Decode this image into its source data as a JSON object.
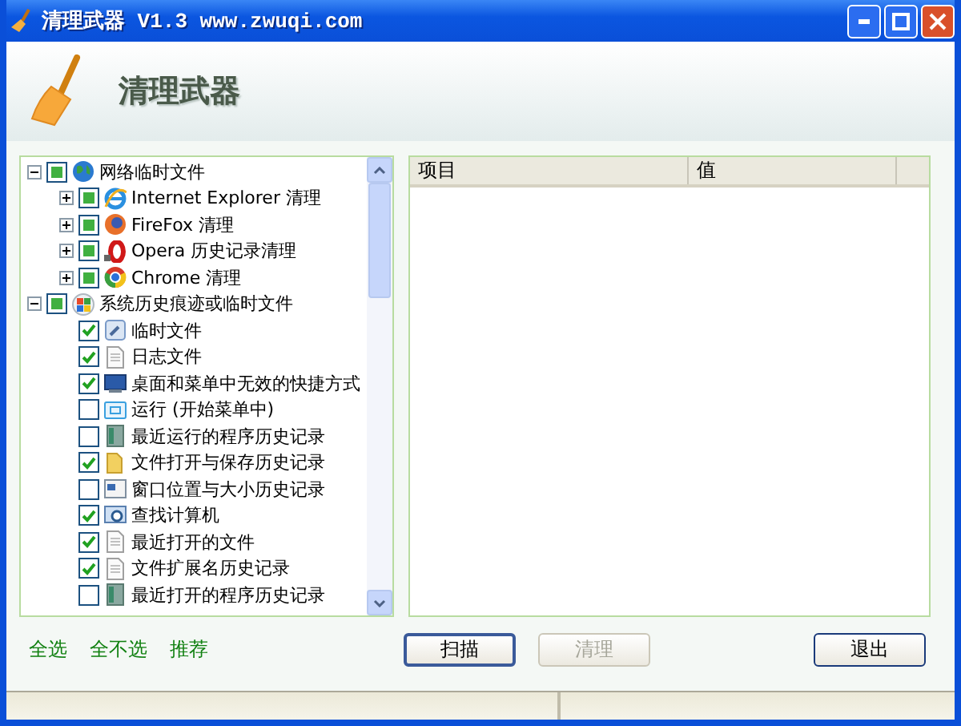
{
  "window": {
    "title": "清理武器 V1.3 www.zwuqi.com"
  },
  "header": {
    "title": "清理武器"
  },
  "tree": [
    {
      "label": "网络临时文件",
      "checked": false,
      "partial": true,
      "expanded": true,
      "children": [
        {
          "label": "Internet Explorer 清理",
          "checked": false,
          "partial": true,
          "expanded": false
        },
        {
          "label": "FireFox 清理",
          "checked": false,
          "partial": true,
          "expanded": false
        },
        {
          "label": "Opera 历史记录清理",
          "checked": false,
          "partial": true,
          "expanded": false
        },
        {
          "label": "Chrome 清理",
          "checked": false,
          "partial": true,
          "expanded": false
        }
      ]
    },
    {
      "label": "系统历史痕迹或临时文件",
      "checked": false,
      "partial": true,
      "expanded": true,
      "children": [
        {
          "label": "临时文件",
          "checked": true
        },
        {
          "label": "日志文件",
          "checked": true
        },
        {
          "label": "桌面和菜单中无效的快捷方式",
          "checked": true
        },
        {
          "label": "运行 (开始菜单中)",
          "checked": false
        },
        {
          "label": "最近运行的程序历史记录",
          "checked": false
        },
        {
          "label": "文件打开与保存历史记录",
          "checked": true
        },
        {
          "label": "窗口位置与大小历史记录",
          "checked": false
        },
        {
          "label": "查找计算机",
          "checked": true
        },
        {
          "label": "最近打开的文件",
          "checked": true
        },
        {
          "label": "文件扩展名历史记录",
          "checked": true
        },
        {
          "label": "最近打开的程序历史记录",
          "checked": false
        }
      ]
    }
  ],
  "table": {
    "columns": [
      "项目",
      "值"
    ]
  },
  "links": [
    "全选",
    "全不选",
    "推荐"
  ],
  "buttons": [
    {
      "label": "扫描",
      "disabled": false,
      "selected": true
    },
    {
      "label": "清理",
      "disabled": true,
      "selected": false
    },
    {
      "label": "退出",
      "disabled": false,
      "selected": false
    }
  ]
}
